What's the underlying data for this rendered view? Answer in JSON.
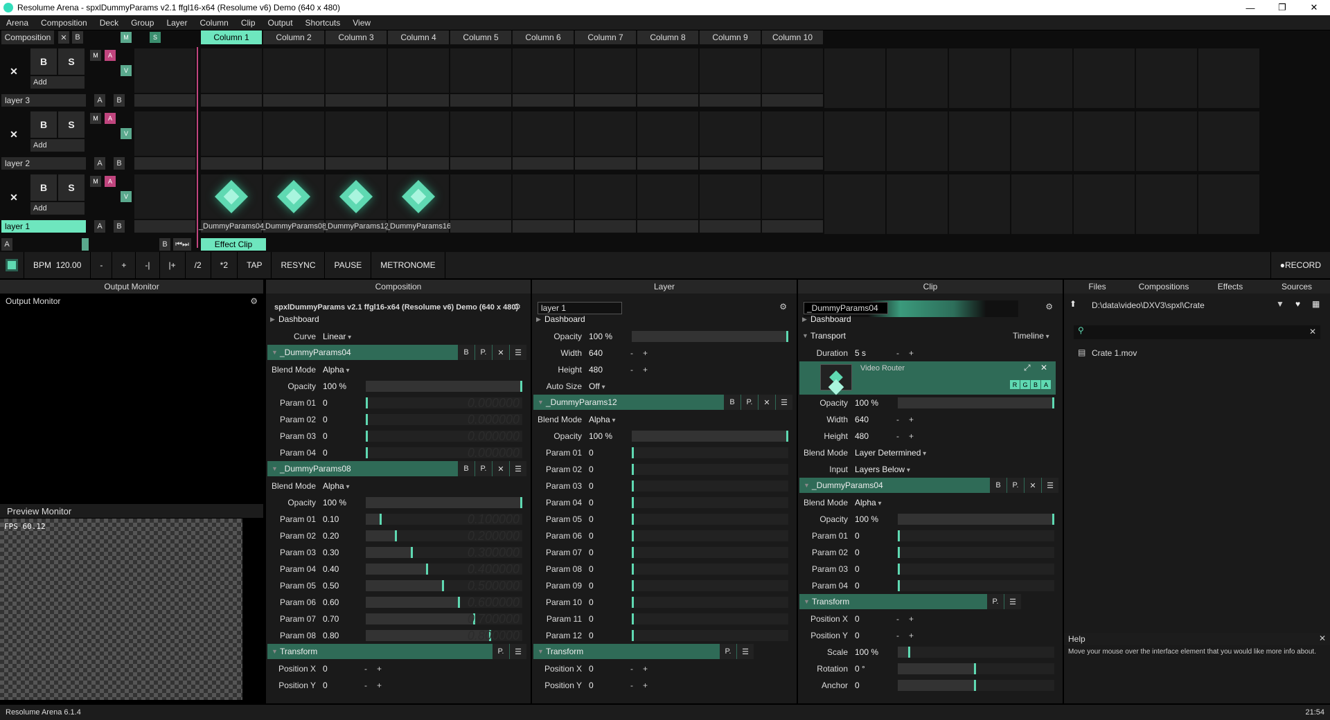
{
  "title": "Resolume Arena - spxlDummyParams v2.1 ffgl16-x64 (Resolume v6) Demo (640 x 480)",
  "menu": [
    "Arena",
    "Composition",
    "Deck",
    "Group",
    "Layer",
    "Column",
    "Clip",
    "Output",
    "Shortcuts",
    "View"
  ],
  "comp_label": "Composition",
  "columns": [
    "Column 1",
    "Column 2",
    "Column 3",
    "Column 4",
    "Column 5",
    "Column 6",
    "Column 7",
    "Column 8",
    "Column 9",
    "Column 10"
  ],
  "layers": [
    {
      "name": "layer 3",
      "add": "Add"
    },
    {
      "name": "layer 2",
      "add": "Add"
    },
    {
      "name": "layer 1",
      "add": "Add"
    }
  ],
  "clips": [
    "_DummyParams04",
    "_DummyParams08",
    "_DummyParams12",
    "_DummyParams16"
  ],
  "effect_clip": "Effect Clip",
  "transport": {
    "bpm_label": "BPM",
    "bpm": "120.00",
    "minus": "-",
    "plus": "+",
    "nudge_minus": "-|",
    "nudge_plus": "|+",
    "half": "/2",
    "double": "*2",
    "tap": "TAP",
    "resync": "RESYNC",
    "pause": "PAUSE",
    "metronome": "METRONOME",
    "record": "RECORD"
  },
  "panels": {
    "output": "Output Monitor",
    "composition": "Composition",
    "layer": "Layer",
    "clip": "Clip"
  },
  "output_monitor": "Output Monitor",
  "preview": {
    "title": "Preview Monitor",
    "fps": "FPS 60.12"
  },
  "comp": {
    "name": "spxlDummyParams v2.1 ffgl16-x64 (Resolume v6) Demo (640 x 480)",
    "dashboard": "Dashboard",
    "curve_label": "Curve",
    "curve": "Linear",
    "fx1": {
      "name": "_DummyParams04",
      "blend_label": "Blend Mode",
      "blend": "Alpha",
      "opacity_label": "Opacity",
      "opacity": "100 %",
      "opacity_level": 1.0,
      "params": [
        {
          "label": "Param 01",
          "value": "0",
          "level": 0,
          "ghost": "0.000000"
        },
        {
          "label": "Param 02",
          "value": "0",
          "level": 0,
          "ghost": "0.000000"
        },
        {
          "label": "Param 03",
          "value": "0",
          "level": 0,
          "ghost": "0.000000"
        },
        {
          "label": "Param 04",
          "value": "0",
          "level": 0,
          "ghost": "0.000000"
        }
      ]
    },
    "fx2": {
      "name": "_DummyParams08",
      "blend_label": "Blend Mode",
      "blend": "Alpha",
      "opacity_label": "Opacity",
      "opacity": "100 %",
      "opacity_level": 1.0,
      "params": [
        {
          "label": "Param 01",
          "value": "0.10",
          "level": 0.1,
          "ghost": "0.100000"
        },
        {
          "label": "Param 02",
          "value": "0.20",
          "level": 0.2,
          "ghost": "0.200000"
        },
        {
          "label": "Param 03",
          "value": "0.30",
          "level": 0.3,
          "ghost": "0.300000"
        },
        {
          "label": "Param 04",
          "value": "0.40",
          "level": 0.4,
          "ghost": "0.400000"
        },
        {
          "label": "Param 05",
          "value": "0.50",
          "level": 0.5,
          "ghost": "0.500000"
        },
        {
          "label": "Param 06",
          "value": "0.60",
          "level": 0.6,
          "ghost": "0.600000"
        },
        {
          "label": "Param 07",
          "value": "0.70",
          "level": 0.7,
          "ghost": "0.700000"
        },
        {
          "label": "Param 08",
          "value": "0.80",
          "level": 0.8,
          "ghost": "0.800000"
        }
      ]
    },
    "transform": "Transform",
    "posx_label": "Position X",
    "posx": "0",
    "posy_label": "Position Y",
    "posy": "0"
  },
  "layer": {
    "name": "layer 1",
    "dashboard": "Dashboard",
    "opacity_label": "Opacity",
    "opacity": "100 %",
    "opacity_level": 1.0,
    "width_label": "Width",
    "width": "640",
    "height_label": "Height",
    "height": "480",
    "autosize_label": "Auto Size",
    "autosize": "Off",
    "fx": {
      "name": "_DummyParams12",
      "blend_label": "Blend Mode",
      "blend": "Alpha",
      "opacity_label": "Opacity",
      "opacity": "100 %",
      "opacity_level": 1.0,
      "params": [
        {
          "label": "Param 01",
          "value": "0"
        },
        {
          "label": "Param 02",
          "value": "0"
        },
        {
          "label": "Param 03",
          "value": "0"
        },
        {
          "label": "Param 04",
          "value": "0"
        },
        {
          "label": "Param 05",
          "value": "0"
        },
        {
          "label": "Param 06",
          "value": "0"
        },
        {
          "label": "Param 07",
          "value": "0"
        },
        {
          "label": "Param 08",
          "value": "0"
        },
        {
          "label": "Param 09",
          "value": "0"
        },
        {
          "label": "Param 10",
          "value": "0"
        },
        {
          "label": "Param 11",
          "value": "0"
        },
        {
          "label": "Param 12",
          "value": "0"
        }
      ]
    },
    "transform": "Transform",
    "posx_label": "Position X",
    "posx": "0",
    "posy_label": "Position Y",
    "posy": "0"
  },
  "clip": {
    "name": "_DummyParams04",
    "dashboard": "Dashboard",
    "transport": "Transport",
    "timeline": "Timeline",
    "duration_label": "Duration",
    "duration": "5 s",
    "router": "Video Router",
    "rgba": [
      "R",
      "G",
      "B",
      "A"
    ],
    "opacity_label": "Opacity",
    "opacity": "100 %",
    "width_label": "Width",
    "width": "640",
    "height_label": "Height",
    "height": "480",
    "blend_label": "Blend Mode",
    "blend": "Layer Determined",
    "input_label": "Input",
    "input": "Layers Below",
    "fx": {
      "name": "_DummyParams04",
      "blend_label": "Blend Mode",
      "blend": "Alpha",
      "opacity_label": "Opacity",
      "opacity": "100 %",
      "params": [
        {
          "label": "Param 01",
          "value": "0"
        },
        {
          "label": "Param 02",
          "value": "0"
        },
        {
          "label": "Param 03",
          "value": "0"
        },
        {
          "label": "Param 04",
          "value": "0"
        }
      ]
    },
    "transform": "Transform",
    "posx_label": "Position X",
    "posx": "0",
    "posy_label": "Position Y",
    "posy": "0",
    "scale_label": "Scale",
    "scale": "100 %",
    "rotation_label": "Rotation",
    "rotation": "0 °",
    "anchor_label": "Anchor",
    "anchor": "0"
  },
  "browser": {
    "tabs": [
      "Files",
      "Compositions",
      "Effects",
      "Sources"
    ],
    "path": "D:\\data\\video\\DXV3\\spxl\\Crate",
    "files": [
      "Crate 1.mov"
    ]
  },
  "help": {
    "title": "Help",
    "text": "Move your mouse over the interface element that you would like more info about."
  },
  "status": {
    "left": "Resolume Arena 6.1.4",
    "right": "21:54"
  }
}
